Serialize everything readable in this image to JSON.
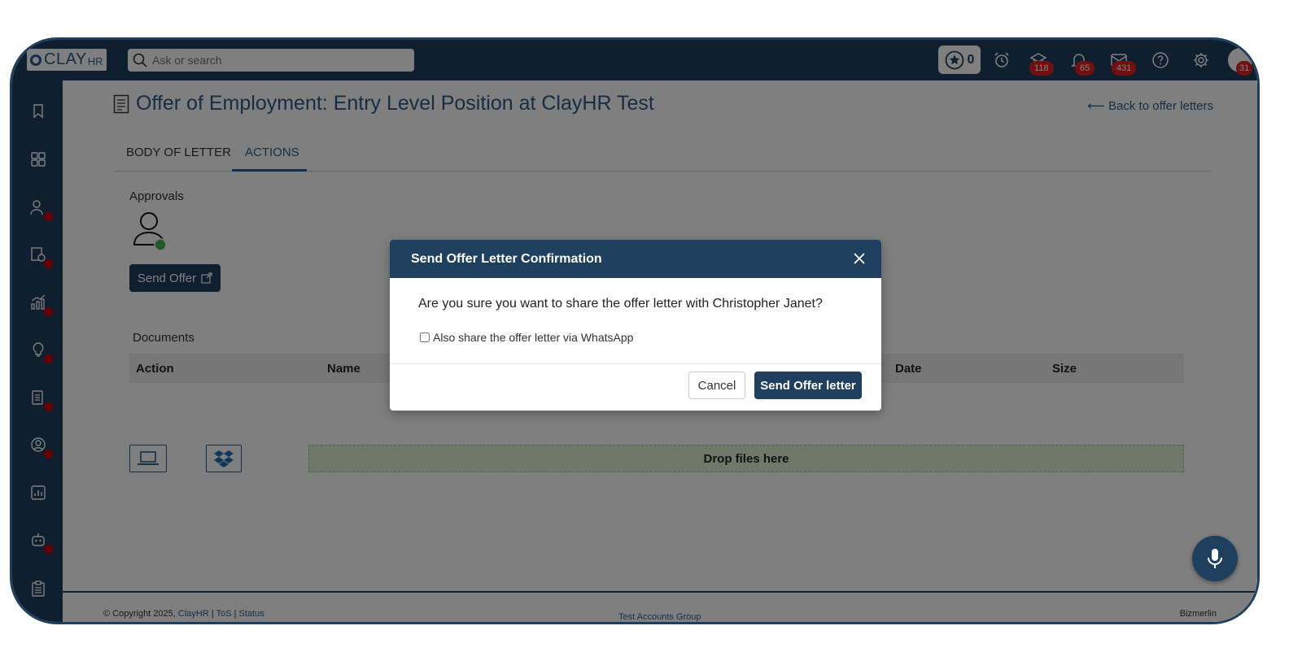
{
  "header": {
    "logo_text": "CLAY",
    "logo_suffix": "HR",
    "search_placeholder": "Ask or search",
    "points_count": "0",
    "badges": {
      "learning": "118",
      "notifications": "65",
      "messages": "431",
      "profile": "31"
    }
  },
  "page": {
    "title": "Offer of Employment: Entry Level Position at ClayHR Test",
    "back_link": "⟵ Back to offer letters",
    "tabs": [
      {
        "label": "BODY OF LETTER",
        "active": false
      },
      {
        "label": "ACTIONS",
        "active": true
      }
    ],
    "approvals_label": "Approvals",
    "send_offer_label": "Send Offer",
    "documents_label": "Documents",
    "documents_columns": [
      "Action",
      "Name",
      "Date",
      "Size"
    ],
    "dropzone_text": "Drop files here"
  },
  "footer": {
    "copyright": "© Copyright 2025,",
    "brand_link": "ClayHR",
    "tos": "ToS",
    "status": "Status",
    "group": "Test Accounts Group",
    "company": "Bizmerlin"
  },
  "modal": {
    "title": "Send Offer Letter Confirmation",
    "question": "Are you sure you want to share the offer letter with Christopher Janet?",
    "whatsapp_label": "Also share the offer letter via WhatsApp",
    "whatsapp_checked": false,
    "cancel_label": "Cancel",
    "confirm_label": "Send Offer letter"
  },
  "colors": {
    "primary": "#1f3f5f",
    "accent": "#2c5d8a",
    "badge": "#e02020",
    "dropzone": "#dff2d3"
  }
}
